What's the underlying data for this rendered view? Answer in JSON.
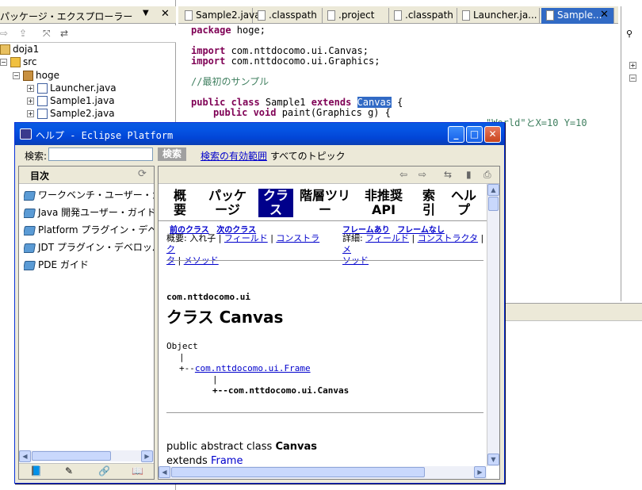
{
  "package_explorer": {
    "title": "パッケージ・エクスプローラー",
    "tree": [
      {
        "label": "doja1",
        "level": 0
      },
      {
        "label": "src",
        "level": 1
      },
      {
        "label": "hoge",
        "level": 2
      },
      {
        "label": "Launcher.java",
        "level": 3
      },
      {
        "label": "Sample1.java",
        "level": 3
      },
      {
        "label": "Sample2.java",
        "level": 3
      }
    ]
  },
  "editor": {
    "tabs": [
      "Sample2.java",
      ".classpath",
      ".project",
      ".classpath",
      "Launcher.ja...",
      "Sample..."
    ],
    "code": {
      "l1_kw": "package",
      "l1_rest": " hoge;",
      "l2_kw": "import",
      "l2_rest": " com.nttdocomo.ui.Canvas;",
      "l3_kw": "import",
      "l3_rest": " com.nttdocomo.ui.Graphics;",
      "l4_comment": "//最初のサンプル",
      "l5_kw1": "public class",
      "l5_mid": " Sample1 ",
      "l5_kw2": "extends",
      "l5_sel": "Canvas",
      "l5_end": " {",
      "l6_kw": "public void",
      "l6_rest": " paint(Graphics g) {",
      "l7_partial": "\"World\"とX=10 Y=10"
    }
  },
  "help_window": {
    "title": "ヘルプ - Eclipse Platform",
    "search_label": "検索:",
    "search_value": "",
    "search_button": "検索",
    "search_scope_link": "検索の有効範囲",
    "search_scope_value": "すべてのトピック",
    "toc_title": "目次",
    "toc_items": [
      "ワークベンチ・ユーザー・ガイド",
      "Java 開発ユーザー・ガイド",
      "Platform プラグイン・デベロッパー",
      "JDT プラグイン・デベロッパー",
      "PDE ガイド"
    ],
    "doc": {
      "nav": [
        "概要",
        "パッケージ",
        "クラス",
        "階層ツリー",
        "非推奨 API",
        "索引",
        "ヘルプ"
      ],
      "prev_class": "前のクラス",
      "next_class": "次のクラス",
      "frames": "フレームあり",
      "no_frames": "フレームなし",
      "summary_label": "概要:",
      "summary_nested": "入れ子",
      "summary_field": "フィールド",
      "summary_constructor": "コンストラク",
      "summary_constructor2": "タ",
      "summary_method": "メソッド",
      "detail_label": "詳細:",
      "detail_field": "フィールド",
      "detail_constructor": "コンストラクタ",
      "detail_method": "メ",
      "detail_method2": "ソッド",
      "package_name": "com.nttdocomo.ui",
      "class_heading": "クラス Canvas",
      "hier_object": "Object",
      "hier_frame_prefix": "+--",
      "hier_frame": "com.nttdocomo.ui.Frame",
      "hier_canvas": "+--com.nttdocomo.ui.Canvas",
      "decl_prefix": "public abstract class ",
      "decl_class": "Canvas",
      "extends_label": "extends ",
      "extends_class": "Frame"
    }
  }
}
